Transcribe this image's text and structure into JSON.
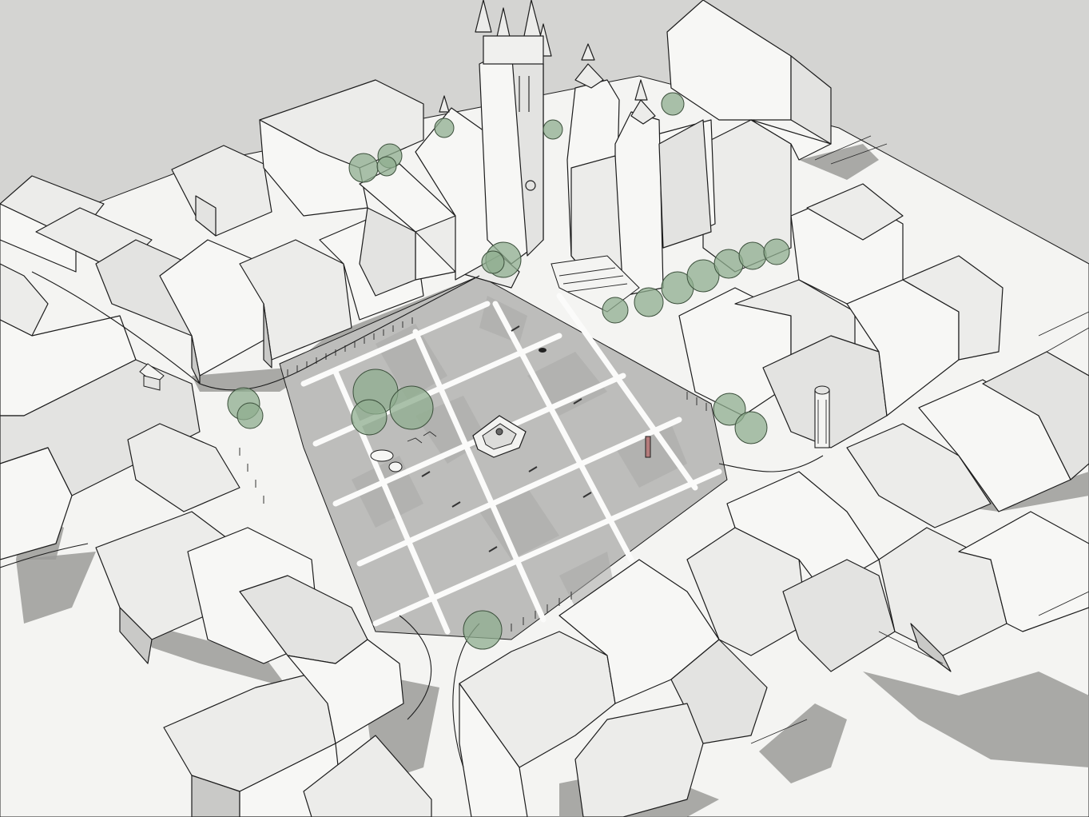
{
  "scene": {
    "colors": {
      "background": "#d4d4d2",
      "ground": "#f4f4f2",
      "square_paving": "#bdbdbb",
      "square_paving_dark": "#a9a9a7",
      "wall_light": "#f7f7f5",
      "wall_mid": "#e3e3e1",
      "wall_dark": "#c9c9c7",
      "roof": "#ececea",
      "shadow": "#9b9b99",
      "tree": "#8fae8f",
      "outline": "#1c1c1c"
    },
    "icons": [
      "tree-icon",
      "fountain-icon",
      "tower-icon",
      "column-icon"
    ]
  }
}
